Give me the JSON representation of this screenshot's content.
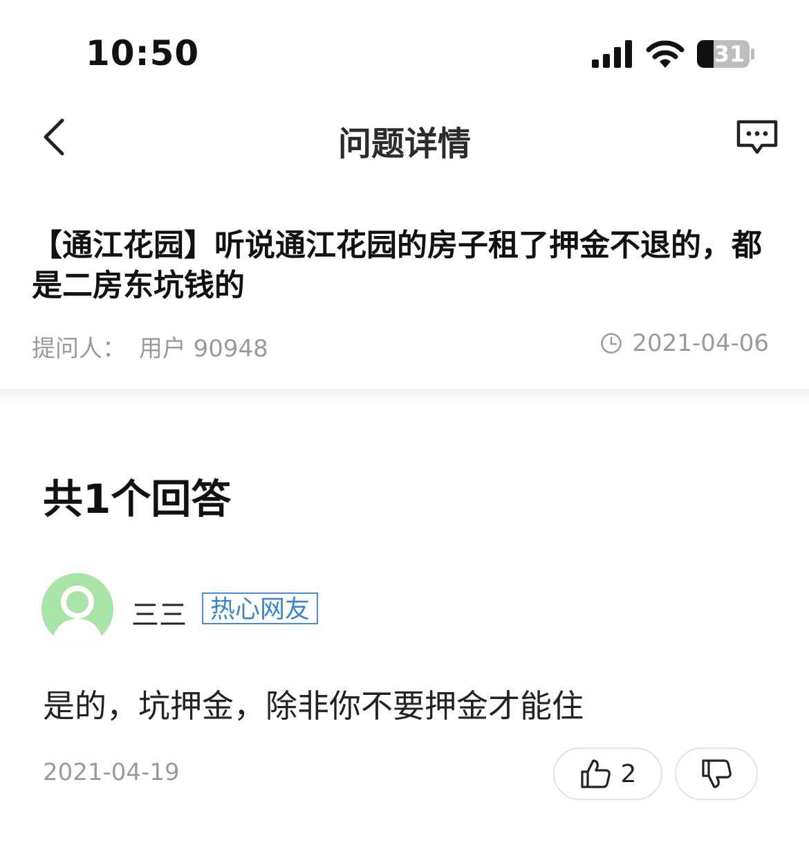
{
  "status_bar": {
    "time": "10:50",
    "battery": "31"
  },
  "nav": {
    "title": "问题详情"
  },
  "question": {
    "title": "【通江花园】听说通江花园的房子租了押金不退的，都是二房东坑钱的",
    "asker_label": "提问人：",
    "asker_name": "用户 90948",
    "date": "2021-04-06"
  },
  "answers_header": "共1个回答",
  "answer": {
    "user_name": "三三",
    "badge": "热心网友",
    "text": "是的，坑押金，除非你不要押金才能住",
    "date": "2021-04-19",
    "like_count": "2"
  }
}
